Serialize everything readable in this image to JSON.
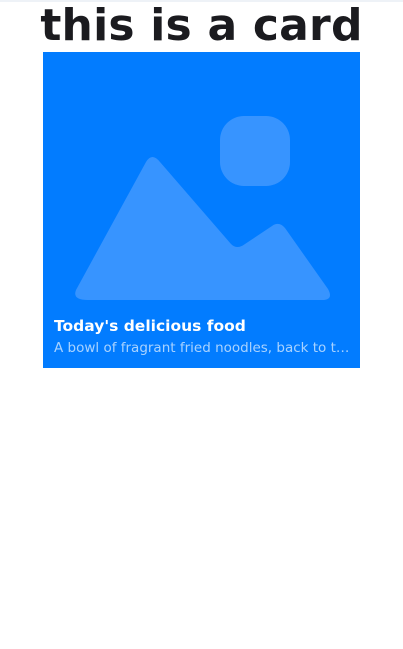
{
  "page": {
    "title": "this is a card"
  },
  "card": {
    "image_icon": "image-placeholder-icon",
    "title": "Today's delicious food",
    "description": "A bowl of fragrant fried noodles, back to the taste of childhood"
  },
  "colors": {
    "background": "#ffffff",
    "card_background": "#027cff",
    "title_text": "#1b1b1f",
    "card_text": "#ffffff"
  }
}
